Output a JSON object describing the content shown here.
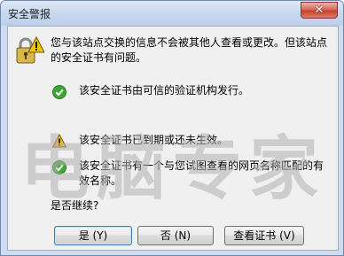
{
  "window": {
    "title": "安全警报",
    "close_glyph": "✕"
  },
  "message": "您与该站点交换的信息不会被其他人查看或更改。但该站点的安全证书有问题。",
  "items": [
    {
      "icon": "check-icon",
      "status": "ok",
      "text": "该安全证书由可信的验证机构发行。"
    },
    {
      "icon": "warning-icon",
      "status": "warning",
      "text": "该安全证书已到期或还未生效。"
    },
    {
      "icon": "check-icon",
      "status": "ok",
      "text": "该安全证书有一个与您试图查看的网页名称匹配的有效名称。"
    }
  ],
  "question": "是否继续?",
  "buttons": {
    "yes": "是 (Y)",
    "no": "否 (N)",
    "view": "查看证书 (V)"
  },
  "watermark": "电脑专家",
  "colors": {
    "ok": "#3fa537",
    "warning": "#f2c200",
    "titlebar": "#c9d9ee",
    "watermark": "#a9a9a9"
  }
}
